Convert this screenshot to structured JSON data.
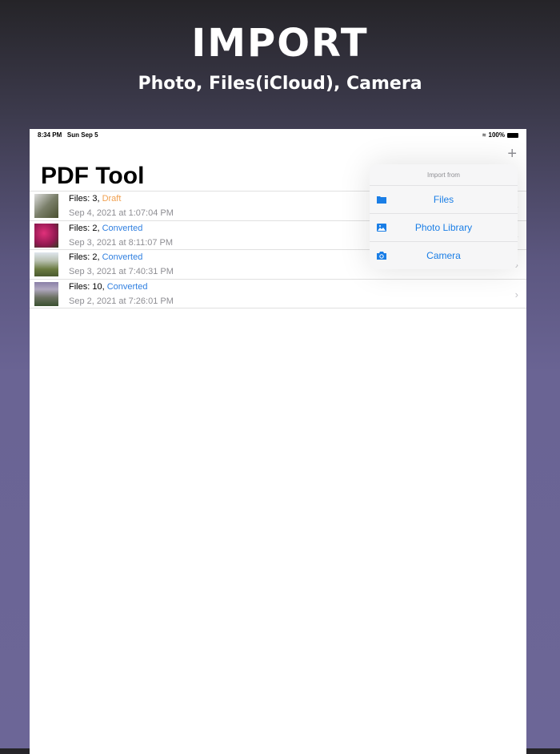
{
  "hero": {
    "title": "IMPORT",
    "subtitle": "Photo, Files(iCloud), Camera"
  },
  "status": {
    "time": "8:34 PM",
    "date": "Sun Sep 5",
    "battery": "100%"
  },
  "app": {
    "title": "PDF Tool"
  },
  "rows": [
    {
      "files": "Files: 3, ",
      "state": "Draft",
      "state_color": "#f0a050",
      "date": "Sep 4, 2021 at 1:07:04 PM",
      "thumb": "#7a7f6a"
    },
    {
      "files": "Files: 2, ",
      "state": "Converted",
      "state_color": "#2f7fe0",
      "date": "Sep 3, 2021 at 8:11:07 PM",
      "thumb": "#b0205a"
    },
    {
      "files": "Files: 2, ",
      "state": "Converted",
      "state_color": "#2f7fe0",
      "date": "Sep 3, 2021 at 7:40:31 PM",
      "thumb": "#7a8a5a"
    },
    {
      "files": "Files: 10, ",
      "state": "Converted",
      "state_color": "#2f7fe0",
      "date": "Sep 2, 2021 at 7:26:01 PM",
      "thumb": "#6a7060"
    }
  ],
  "popover": {
    "header": "Import from",
    "items": [
      {
        "label": "Files",
        "icon": "folder-icon"
      },
      {
        "label": "Photo Library",
        "icon": "photo-icon"
      },
      {
        "label": "Camera",
        "icon": "camera-icon"
      }
    ]
  }
}
